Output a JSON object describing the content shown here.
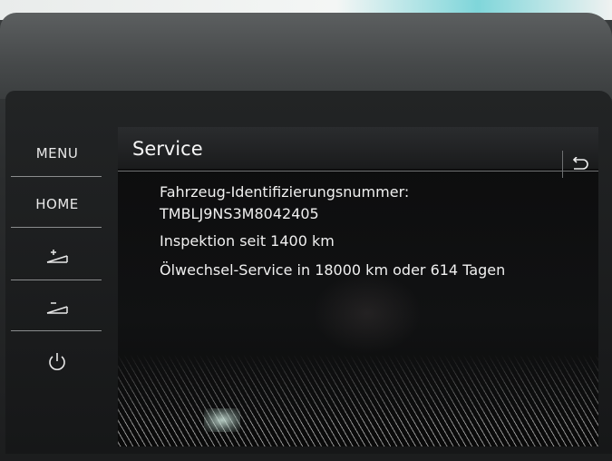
{
  "hardware_buttons": {
    "menu": "MENU",
    "home": "HOME",
    "brightness_up": "brightness-up-icon",
    "brightness_down": "brightness-down-icon",
    "power": "power-icon"
  },
  "screen": {
    "title": "Service",
    "back_icon": "back-arrow-icon",
    "vin_label": "Fahrzeug-Identifizierungsnummer:",
    "vin_value": "TMBLJ9NS3M8042405",
    "inspection": "Inspektion seit 1400 km",
    "oil_service": "Ölwechsel-Service in 18000 km oder 614 Tagen"
  },
  "colors": {
    "text": "#f0f0f0",
    "screen_bg": "#0c0c0d",
    "bezel": "#1c1d1e"
  }
}
